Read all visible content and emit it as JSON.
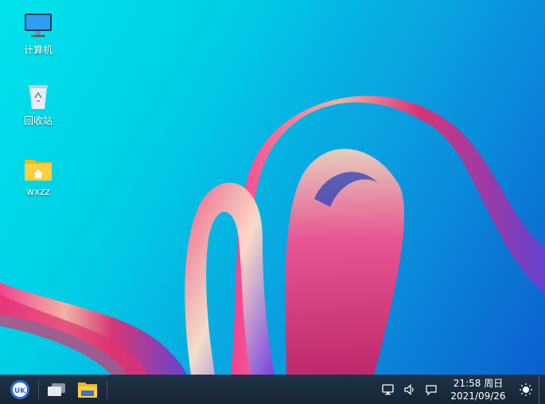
{
  "desktop": {
    "icons": [
      {
        "label": "计算机",
        "icon": "computer-icon"
      },
      {
        "label": "回收站",
        "icon": "trash-icon"
      },
      {
        "label": "wxzz",
        "icon": "home-folder-icon"
      }
    ]
  },
  "taskbar": {
    "start_icon": "start-menu-icon",
    "multitask_icon": "multitask-view-icon",
    "files_icon": "file-manager-icon",
    "tray": [
      "network-icon",
      "volume-icon",
      "notification-icon",
      "night-mode-icon"
    ],
    "clock": {
      "time_day": "21:58 周日",
      "date": "2021/09/26"
    }
  }
}
